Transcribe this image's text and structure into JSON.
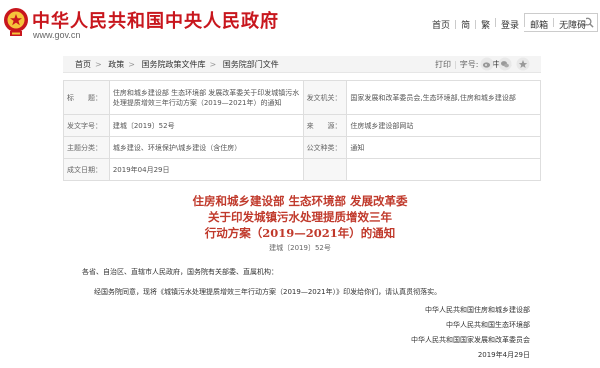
{
  "header": {
    "site_title": "中华人民共和国中央人民政府",
    "site_url": "www.gov.cn",
    "nav": [
      "首页",
      "简",
      "繁",
      "EN",
      "登录",
      "邮箱",
      "无障碍"
    ],
    "brand_color": "#c8161d"
  },
  "breadcrumb": {
    "items": [
      "首页",
      "政策",
      "国务院政策文件库",
      "国务院部门文件"
    ],
    "print": "打印",
    "font_label": "字号:",
    "font_sizes": [
      "大",
      "中",
      "小"
    ]
  },
  "info": {
    "subject_label": "标　　题：",
    "subject_value": "住房和城乡建设部 生态环境部 发展改革委关于印发城镇污水处理提质增效三年行动方案（2019—2021年）的通知",
    "issuer_label": "发文机关：",
    "issuer_value": "国家发展和改革委员会,生态环境部,住房和城乡建设部",
    "docno_label": "发文字号：",
    "docno_value": "建城〔2019〕52号",
    "source_label": "来　　源：",
    "source_value": "住房城乡建设部网站",
    "topic_label": "主题分类：",
    "topic_value": "城乡建设、环境保护\\城乡建设（含住房）",
    "type_label": "公文种类：",
    "type_value": "通知",
    "date_label": "成文日期：",
    "date_value": "2019年04月29日"
  },
  "article": {
    "title_lines": [
      "住房和城乡建设部  生态环境部  发展改革委",
      "关于印发城镇污水处理提质增效三年",
      "行动方案（2019—2021年）的通知"
    ],
    "doc_number": "建城〔2019〕52号",
    "addressee": "各省、自治区、直辖市人民政府，国务院有关部委、直属机构：",
    "body": "经国务院同意，现将《城镇污水处理提质增效三年行动方案（2019—2021年）》印发给你们，请认真贯彻落实。",
    "signatories": [
      "中华人民共和国住房和城乡建设部",
      "中华人民共和国生态环境部",
      "中华人民共和国国家发展和改革委员会"
    ],
    "date": "2019年4月29日",
    "title_color": "#c0392b"
  }
}
